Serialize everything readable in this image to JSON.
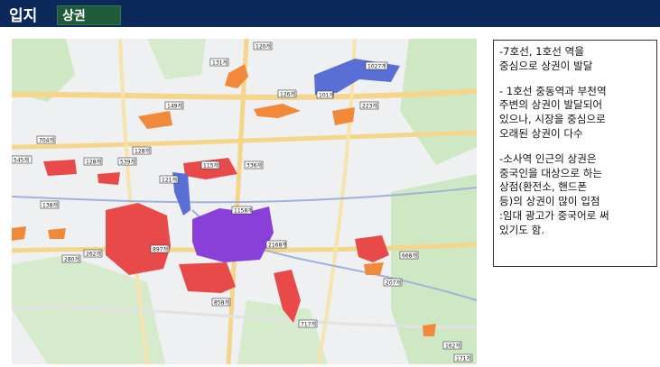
{
  "header": {
    "title": "입지",
    "section": "상권"
  },
  "info": {
    "paragraphs": [
      "-7호선, 1호선 역을\n중심으로 상권이 발달",
      "- 1호선 중동역과 부천역\n주변의 상권이 발달되어\n있으나, 시장을 중심으로\n오래된 상권이 다수",
      "-소사역 인근의 상권은\n중국인을 대상으로 하는\n상점(환전소, 핸드폰\n등)의 상권이 많이 입점\n:임대 광고가 중국어로 써\n있기도 함."
    ]
  },
  "map": {
    "colors": {
      "red": "#e84a4a",
      "orange": "#f08a3a",
      "blue": "#5a6fd6",
      "purple": "#8a3fd8",
      "road": "#f5d58a",
      "green": "#cfe8c4"
    },
    "labels": {
      "l1": "120개",
      "l2": "131개",
      "l3": "1027개",
      "l4": "126개",
      "l5": "101개",
      "l6": "149개",
      "l7": "223개",
      "l8": "704개",
      "l9": "545개",
      "l10": "128개",
      "l11": "539개",
      "l12": "128개",
      "l13": "115개",
      "l14": "336개",
      "l15": "121개",
      "l16": "138개",
      "l17": "1158개",
      "l18": "280개",
      "l19": "262개",
      "l20": "897개",
      "l21": "2168개",
      "l22": "668개",
      "l23": "207개",
      "l24": "858개",
      "l25": "717개",
      "l26": "162개",
      "l27": "171개"
    }
  }
}
